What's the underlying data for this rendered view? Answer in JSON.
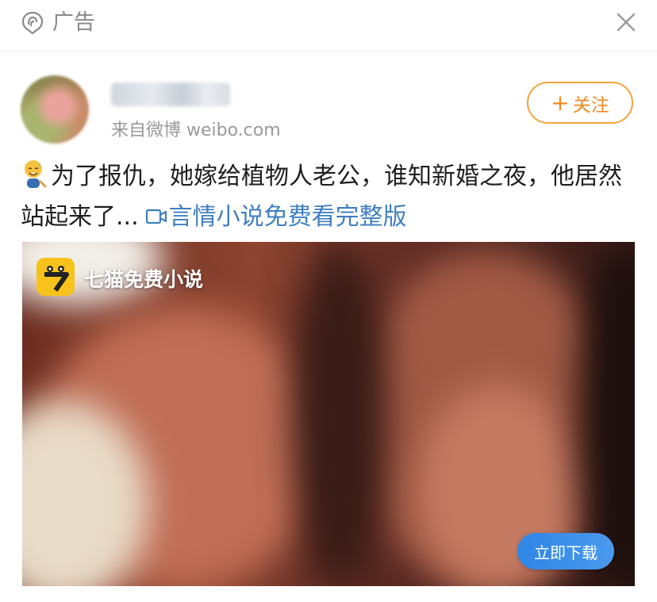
{
  "ad_header": {
    "label": "广告",
    "ad_icon": "ad-badge-icon",
    "close_icon": "close-icon"
  },
  "post": {
    "author": {
      "name": "",
      "source": "来自微博 weibo.com",
      "avatar": "blurred-avatar"
    },
    "follow_label": "关注",
    "follow_color": "#f18a1e",
    "text": "为了报仇，她嫁给植物人老公，谁知新婚之夜，他居然站起来了...",
    "emoji": "sweat-smile-emoji-icon",
    "link_label": "言情小说免费看完整版",
    "link_color": "#3f7fbf",
    "video_icon": "video-icon"
  },
  "media": {
    "app_name": "七猫免费小说",
    "logo_badge": "7",
    "download_label": "立即下载",
    "download_color": "#2f86e6"
  }
}
